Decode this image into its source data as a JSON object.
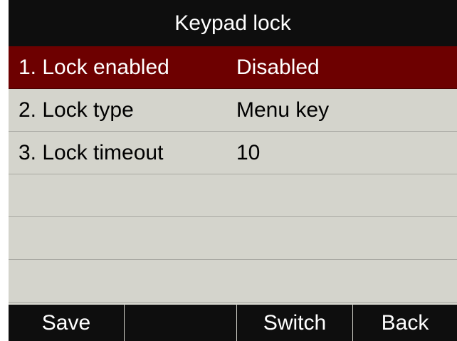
{
  "title": "Keypad lock",
  "menu": {
    "items": [
      {
        "label": "1. Lock enabled",
        "value": "Disabled"
      },
      {
        "label": "2. Lock type",
        "value": "Menu key"
      },
      {
        "label": "3. Lock timeout",
        "value": "10"
      }
    ],
    "selected_index": 0
  },
  "softkeys": [
    "Save",
    "",
    "Switch",
    "Back"
  ],
  "colors": {
    "title_bar_bg": "#0e0e0e",
    "selected_row_bg": "#6d0000",
    "list_bg": "#d4d4cc",
    "softkey_bar_bg": "#0e0e0e"
  }
}
